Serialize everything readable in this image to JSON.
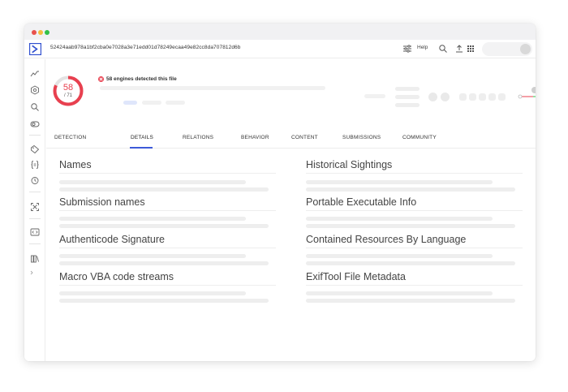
{
  "window": {
    "controls": [
      "close",
      "minimize",
      "maximize"
    ],
    "colors": {
      "close": "#e8514c",
      "minimize": "#f4bd3e",
      "maximize": "#32c048"
    }
  },
  "header": {
    "file_hash": "52424aab978a1bf2cba0e7028a3e71edd01d78249ecaa49e82cc8da707812d6b",
    "help_label": "Help",
    "icons": [
      "logo-icon",
      "filters-icon",
      "search-icon",
      "upload-icon",
      "apps-grid-icon"
    ]
  },
  "sidebar": {
    "icons": [
      "activity-icon",
      "hexagon-network-icon",
      "search-icon",
      "toggle-icon",
      "tag-icon",
      "braces-icon",
      "timer-icon",
      "expand-icon",
      "code-icon",
      "library-icon"
    ]
  },
  "summary": {
    "detections": "58",
    "total_engines": "/ 71",
    "detections_ratio": 0.8169,
    "detection_message": "58 engines detected this file",
    "accent_color": "#e8404f"
  },
  "tabs": [
    {
      "label": "DETECTION"
    },
    {
      "label": "DETAILS",
      "active": true
    },
    {
      "label": "RELATIONS"
    },
    {
      "label": "BEHAVIOR"
    },
    {
      "label": "CONTENT"
    },
    {
      "label": "SUBMISSIONS"
    },
    {
      "label": "COMMUNITY"
    }
  ],
  "active_tab_color": "#3d5ad9",
  "sections": {
    "left": [
      "Names",
      "Submission names",
      "Authenticode Signature",
      "Macro VBA code streams"
    ],
    "right": [
      "Historical Sightings",
      "Portable Executable Info",
      "Contained Resources By Language",
      "ExifTool File Metadata"
    ]
  }
}
